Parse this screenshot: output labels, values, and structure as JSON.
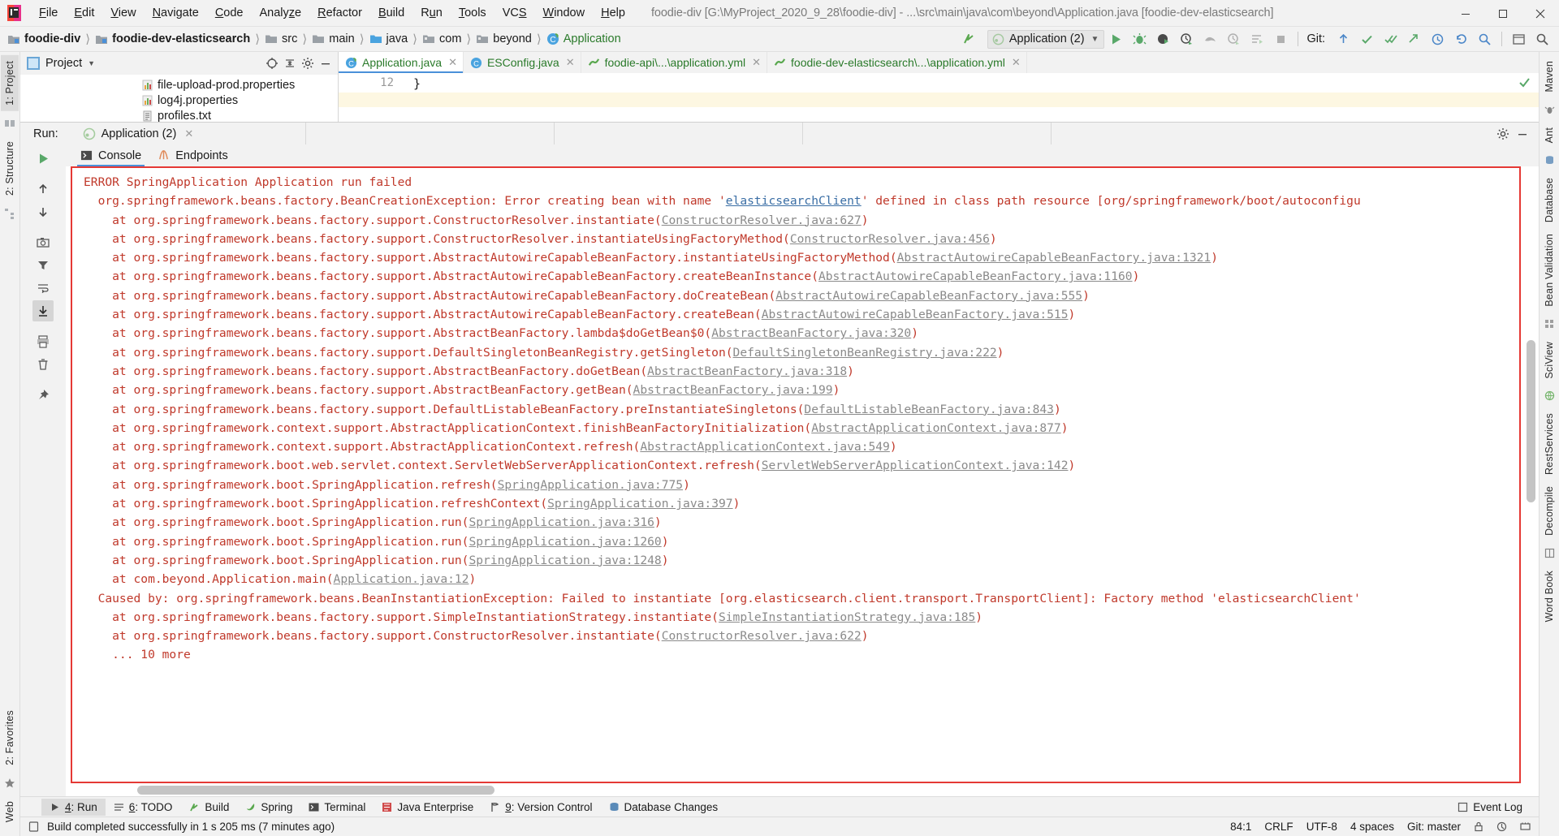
{
  "window": {
    "title": "foodie-div [G:\\MyProject_2020_9_28\\foodie-div] - ...\\src\\main\\java\\com\\beyond\\Application.java [foodie-dev-elasticsearch]",
    "minimize_label": "Minimize",
    "maximize_label": "Maximize",
    "close_label": "Close"
  },
  "menu": [
    {
      "label": "File"
    },
    {
      "label": "Edit"
    },
    {
      "label": "View"
    },
    {
      "label": "Navigate"
    },
    {
      "label": "Code"
    },
    {
      "label": "Analyze"
    },
    {
      "label": "Refactor"
    },
    {
      "label": "Build"
    },
    {
      "label": "Run"
    },
    {
      "label": "Tools"
    },
    {
      "label": "VCS"
    },
    {
      "label": "Window"
    },
    {
      "label": "Help"
    }
  ],
  "breadcrumb": [
    {
      "label": "foodie-div",
      "icon": "module-icon"
    },
    {
      "label": "foodie-dev-elasticsearch",
      "icon": "module-icon"
    },
    {
      "label": "src",
      "icon": "folder-icon"
    },
    {
      "label": "main",
      "icon": "folder-icon"
    },
    {
      "label": "java",
      "icon": "source-folder-icon"
    },
    {
      "label": "com",
      "icon": "package-icon"
    },
    {
      "label": "beyond",
      "icon": "package-icon"
    },
    {
      "label": "Application",
      "icon": "spring-class-icon"
    }
  ],
  "toolbar": {
    "run_config_name": "Application (2)",
    "run_label": "Run",
    "debug_label": "Debug",
    "run_coverage_label": "Run with Coverage",
    "profile_label": "Profile",
    "attach_label": "Attach to Process",
    "update_label": "Update Application",
    "stop_label": "Stop",
    "git_label": "Git:",
    "back_arrow_label": "Back"
  },
  "project_panel": {
    "title": "Project",
    "collapse_label": "Collapse All",
    "locate_label": "Select Opened File",
    "settings_label": "Settings",
    "hide_label": "Hide",
    "tree": [
      {
        "label": "file-upload-prod.properties",
        "icon": "properties-icon"
      },
      {
        "label": "log4j.properties",
        "icon": "properties-icon"
      },
      {
        "label": "profiles.txt",
        "icon": "text-file-icon"
      }
    ]
  },
  "editor": {
    "tabs": [
      {
        "label": "Application.java",
        "icon": "spring-class-icon",
        "active": true
      },
      {
        "label": "ESConfig.java",
        "icon": "class-icon",
        "active": false
      },
      {
        "label": "foodie-api\\...\\application.yml",
        "icon": "yml-icon",
        "active": false
      },
      {
        "label": "foodie-dev-elasticsearch\\...\\application.yml",
        "icon": "yml-icon",
        "active": false
      }
    ],
    "line_number": "12",
    "code_line": "}"
  },
  "run_window": {
    "label": "Run:",
    "tab_title": "Application (2)",
    "settings_label": "Settings",
    "hide_label": "Hide",
    "console_tabs": [
      {
        "label": "Console",
        "icon": "console-icon",
        "active": true
      },
      {
        "label": "Endpoints",
        "icon": "endpoints-icon",
        "active": false
      }
    ],
    "gutter_buttons": [
      {
        "name": "rerun-button",
        "label": "Rerun"
      },
      {
        "name": "up-stack-button",
        "label": "Up the Stack Trace"
      },
      {
        "name": "down-stack-button",
        "label": "Down the Stack Trace"
      },
      {
        "name": "camera-button",
        "label": "Export Thread Dump"
      },
      {
        "name": "filter-button",
        "label": "Filter"
      },
      {
        "name": "wrap-button",
        "label": "Use Soft Wraps"
      },
      {
        "name": "scroll-end-button",
        "label": "Scroll to End"
      },
      {
        "name": "print-button",
        "label": "Print"
      },
      {
        "name": "clear-button",
        "label": "Clear All"
      },
      {
        "name": "pin-button",
        "label": "Pin Tab"
      }
    ],
    "console_lines": [
      {
        "indent": 0,
        "text": "ERROR SpringApplication Application run failed",
        "links": []
      },
      {
        "indent": 1,
        "text": "org.springframework.beans.factory.BeanCreationException: Error creating bean with name 'elasticsearchClient' defined in class path resource [org/springframework/boot/autoconfigu",
        "links": [
          {
            "text": "elasticsearchClient",
            "style": "blue"
          }
        ]
      },
      {
        "indent": 2,
        "text": "at org.springframework.beans.factory.support.ConstructorResolver.instantiate(ConstructorResolver.java:627)",
        "links": [
          {
            "text": "ConstructorResolver.java:627",
            "style": "gray"
          }
        ]
      },
      {
        "indent": 2,
        "text": "at org.springframework.beans.factory.support.ConstructorResolver.instantiateUsingFactoryMethod(ConstructorResolver.java:456)",
        "links": [
          {
            "text": "ConstructorResolver.java:456",
            "style": "gray"
          }
        ]
      },
      {
        "indent": 2,
        "text": "at org.springframework.beans.factory.support.AbstractAutowireCapableBeanFactory.instantiateUsingFactoryMethod(AbstractAutowireCapableBeanFactory.java:1321)",
        "links": [
          {
            "text": "AbstractAutowireCapableBeanFactory.java:1321",
            "style": "gray"
          }
        ]
      },
      {
        "indent": 2,
        "text": "at org.springframework.beans.factory.support.AbstractAutowireCapableBeanFactory.createBeanInstance(AbstractAutowireCapableBeanFactory.java:1160)",
        "links": [
          {
            "text": "AbstractAutowireCapableBeanFactory.java:1160",
            "style": "gray"
          }
        ]
      },
      {
        "indent": 2,
        "text": "at org.springframework.beans.factory.support.AbstractAutowireCapableBeanFactory.doCreateBean(AbstractAutowireCapableBeanFactory.java:555)",
        "links": [
          {
            "text": "AbstractAutowireCapableBeanFactory.java:555",
            "style": "gray"
          }
        ]
      },
      {
        "indent": 2,
        "text": "at org.springframework.beans.factory.support.AbstractAutowireCapableBeanFactory.createBean(AbstractAutowireCapableBeanFactory.java:515)",
        "links": [
          {
            "text": "AbstractAutowireCapableBeanFactory.java:515",
            "style": "gray"
          }
        ]
      },
      {
        "indent": 2,
        "text": "at org.springframework.beans.factory.support.AbstractBeanFactory.lambda$doGetBean$0(AbstractBeanFactory.java:320)",
        "links": [
          {
            "text": "AbstractBeanFactory.java:320",
            "style": "gray"
          }
        ]
      },
      {
        "indent": 2,
        "text": "at org.springframework.beans.factory.support.DefaultSingletonBeanRegistry.getSingleton(DefaultSingletonBeanRegistry.java:222)",
        "links": [
          {
            "text": "DefaultSingletonBeanRegistry.java:222",
            "style": "gray"
          }
        ]
      },
      {
        "indent": 2,
        "text": "at org.springframework.beans.factory.support.AbstractBeanFactory.doGetBean(AbstractBeanFactory.java:318)",
        "links": [
          {
            "text": "AbstractBeanFactory.java:318",
            "style": "gray"
          }
        ]
      },
      {
        "indent": 2,
        "text": "at org.springframework.beans.factory.support.AbstractBeanFactory.getBean(AbstractBeanFactory.java:199)",
        "links": [
          {
            "text": "AbstractBeanFactory.java:199",
            "style": "gray"
          }
        ]
      },
      {
        "indent": 2,
        "text": "at org.springframework.beans.factory.support.DefaultListableBeanFactory.preInstantiateSingletons(DefaultListableBeanFactory.java:843)",
        "links": [
          {
            "text": "DefaultListableBeanFactory.java:843",
            "style": "gray"
          }
        ]
      },
      {
        "indent": 2,
        "text": "at org.springframework.context.support.AbstractApplicationContext.finishBeanFactoryInitialization(AbstractApplicationContext.java:877)",
        "links": [
          {
            "text": "AbstractApplicationContext.java:877",
            "style": "gray"
          }
        ]
      },
      {
        "indent": 2,
        "text": "at org.springframework.context.support.AbstractApplicationContext.refresh(AbstractApplicationContext.java:549)",
        "links": [
          {
            "text": "AbstractApplicationContext.java:549",
            "style": "gray"
          }
        ]
      },
      {
        "indent": 2,
        "text": "at org.springframework.boot.web.servlet.context.ServletWebServerApplicationContext.refresh(ServletWebServerApplicationContext.java:142)",
        "links": [
          {
            "text": "ServletWebServerApplicationContext.java:142",
            "style": "gray"
          }
        ]
      },
      {
        "indent": 2,
        "text": "at org.springframework.boot.SpringApplication.refresh(SpringApplication.java:775)",
        "links": [
          {
            "text": "SpringApplication.java:775",
            "style": "gray"
          }
        ]
      },
      {
        "indent": 2,
        "text": "at org.springframework.boot.SpringApplication.refreshContext(SpringApplication.java:397)",
        "links": [
          {
            "text": "SpringApplication.java:397",
            "style": "gray"
          }
        ]
      },
      {
        "indent": 2,
        "text": "at org.springframework.boot.SpringApplication.run(SpringApplication.java:316)",
        "links": [
          {
            "text": "SpringApplication.java:316",
            "style": "gray"
          }
        ]
      },
      {
        "indent": 2,
        "text": "at org.springframework.boot.SpringApplication.run(SpringApplication.java:1260)",
        "links": [
          {
            "text": "SpringApplication.java:1260",
            "style": "gray"
          }
        ]
      },
      {
        "indent": 2,
        "text": "at org.springframework.boot.SpringApplication.run(SpringApplication.java:1248)",
        "links": [
          {
            "text": "SpringApplication.java:1248",
            "style": "gray"
          }
        ]
      },
      {
        "indent": 2,
        "text": "at com.beyond.Application.main(Application.java:12)",
        "links": [
          {
            "text": "Application.java:12",
            "style": "gray"
          }
        ]
      },
      {
        "indent": 1,
        "text": "Caused by: org.springframework.beans.BeanInstantiationException: Failed to instantiate [org.elasticsearch.client.transport.TransportClient]: Factory method 'elasticsearchClient'",
        "links": []
      },
      {
        "indent": 2,
        "text": "at org.springframework.beans.factory.support.SimpleInstantiationStrategy.instantiate(SimpleInstantiationStrategy.java:185)",
        "links": [
          {
            "text": "SimpleInstantiationStrategy.java:185",
            "style": "gray"
          }
        ]
      },
      {
        "indent": 2,
        "text": "at org.springframework.beans.factory.support.ConstructorResolver.instantiate(ConstructorResolver.java:622)",
        "links": [
          {
            "text": "ConstructorResolver.java:622",
            "style": "gray"
          }
        ]
      },
      {
        "indent": 2,
        "text": "... 10 more",
        "links": []
      }
    ]
  },
  "left_stripe": {
    "tabs": [
      {
        "label": "1: Project",
        "num": "1",
        "active": true
      },
      {
        "label": "2: Structure",
        "num": "2",
        "active": false
      }
    ],
    "favorites_label": "2: Favorites",
    "web_label": "Web"
  },
  "right_stripe": {
    "tabs": [
      {
        "label": "Maven"
      },
      {
        "label": "Ant"
      },
      {
        "label": "Database"
      },
      {
        "label": "Bean Validation"
      },
      {
        "label": "SciView"
      },
      {
        "label": "RestServices"
      },
      {
        "label": "Decompile"
      },
      {
        "label": "Word Book"
      }
    ]
  },
  "bottom_bar": {
    "items": [
      {
        "label": "4: Run",
        "num": "4",
        "icon": "run-icon",
        "active": true
      },
      {
        "label": "6: TODO",
        "num": "6",
        "icon": "todo-icon",
        "active": false
      },
      {
        "label": "Build",
        "num": "",
        "icon": "build-icon",
        "active": false
      },
      {
        "label": "Spring",
        "num": "",
        "icon": "spring-icon",
        "active": false
      },
      {
        "label": "Terminal",
        "num": "",
        "icon": "terminal-icon",
        "active": false
      },
      {
        "label": "Java Enterprise",
        "num": "",
        "icon": "java-ee-icon",
        "active": false
      },
      {
        "label": "9: Version Control",
        "num": "9",
        "icon": "vcs-icon",
        "active": false
      },
      {
        "label": "Database Changes",
        "num": "",
        "icon": "db-changes-icon",
        "active": false
      }
    ],
    "event_log_label": "Event Log"
  },
  "statusbar": {
    "message": "Build completed successfully in 1 s 205 ms (7 minutes ago)",
    "caret": "84:1",
    "line_sep": "CRLF",
    "encoding": "UTF-8",
    "indent": "4 spaces",
    "branch": "Git: master"
  },
  "colors": {
    "error_red": "#c0392b",
    "border_red": "#e53935",
    "accent_blue": "#4a90d9",
    "green": "#2a7a2a",
    "bg": "#f2f2f2"
  }
}
